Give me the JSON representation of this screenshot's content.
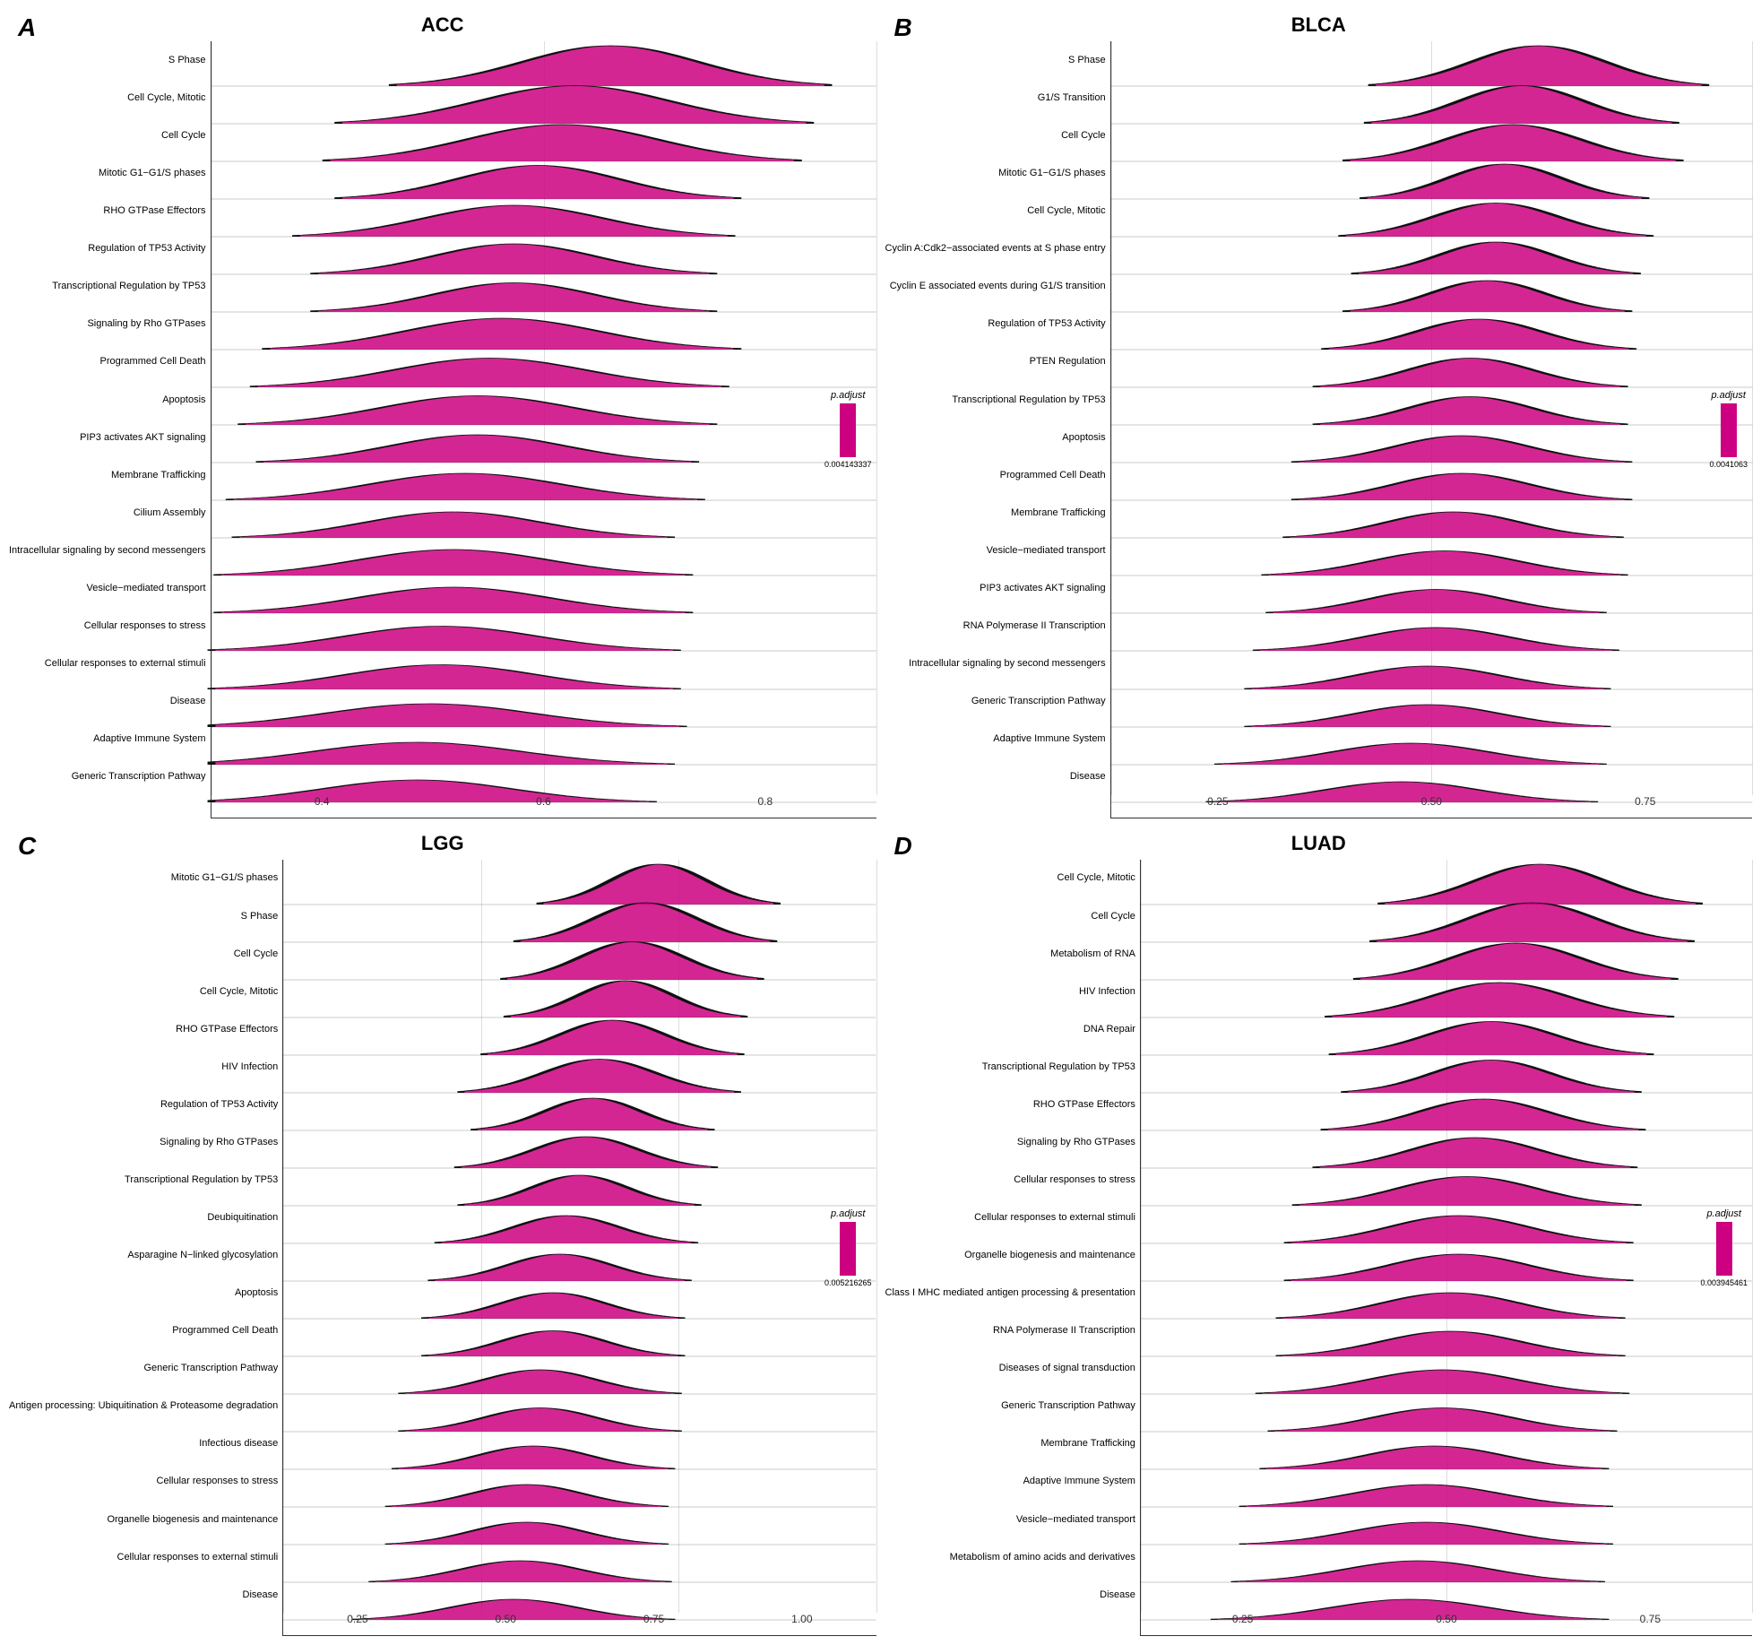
{
  "panels": [
    {
      "id": "A",
      "title": "ACC",
      "legend_value": "0.004143337",
      "x_ticks": [
        "0.4",
        "0.6",
        "0.8"
      ],
      "rows": [
        {
          "label": "S Phase",
          "peak": 0.68,
          "spread": 0.12,
          "height": 0.9
        },
        {
          "label": "Cell Cycle, Mitotic",
          "peak": 0.65,
          "spread": 0.13,
          "height": 0.85
        },
        {
          "label": "Cell Cycle",
          "peak": 0.64,
          "spread": 0.13,
          "height": 0.82
        },
        {
          "label": "Mitotic G1−G1/S phases",
          "peak": 0.62,
          "spread": 0.11,
          "height": 0.75
        },
        {
          "label": "RHO GTPase Effectors",
          "peak": 0.6,
          "spread": 0.12,
          "height": 0.7
        },
        {
          "label": "Regulation of TP53 Activity",
          "peak": 0.6,
          "spread": 0.11,
          "height": 0.68
        },
        {
          "label": "Transcriptional Regulation by TP53",
          "peak": 0.6,
          "spread": 0.11,
          "height": 0.65
        },
        {
          "label": "Signaling by Rho GTPases",
          "peak": 0.59,
          "spread": 0.13,
          "height": 0.7
        },
        {
          "label": "Programmed Cell Death",
          "peak": 0.58,
          "spread": 0.13,
          "height": 0.65
        },
        {
          "label": "Apoptosis",
          "peak": 0.57,
          "spread": 0.13,
          "height": 0.65
        },
        {
          "label": "PIP3 activates AKT signaling",
          "peak": 0.57,
          "spread": 0.12,
          "height": 0.62
        },
        {
          "label": "Membrane Trafficking",
          "peak": 0.56,
          "spread": 0.13,
          "height": 0.6
        },
        {
          "label": "Cilium Assembly",
          "peak": 0.55,
          "spread": 0.12,
          "height": 0.58
        },
        {
          "label": "Intracellular signaling by second messengers",
          "peak": 0.55,
          "spread": 0.13,
          "height": 0.58
        },
        {
          "label": "Vesicle−mediated transport",
          "peak": 0.55,
          "spread": 0.13,
          "height": 0.58
        },
        {
          "label": "Cellular responses to stress",
          "peak": 0.54,
          "spread": 0.13,
          "height": 0.55
        },
        {
          "label": "Cellular responses to external stimuli",
          "peak": 0.54,
          "spread": 0.13,
          "height": 0.55
        },
        {
          "label": "Disease",
          "peak": 0.53,
          "spread": 0.14,
          "height": 0.52
        },
        {
          "label": "Adaptive Immune System",
          "peak": 0.52,
          "spread": 0.14,
          "height": 0.5
        },
        {
          "label": "Generic Transcription Pathway",
          "peak": 0.52,
          "spread": 0.13,
          "height": 0.5
        }
      ],
      "x_min": 0.35,
      "x_max": 0.9
    },
    {
      "id": "B",
      "title": "BLCA",
      "legend_value": "0.0041063",
      "x_ticks": [
        "0.25",
        "0.50",
        "0.75"
      ],
      "rows": [
        {
          "label": "S Phase",
          "peak": 0.65,
          "spread": 0.13,
          "height": 0.9
        },
        {
          "label": "G1/S Transition",
          "peak": 0.63,
          "spread": 0.12,
          "height": 0.85
        },
        {
          "label": "Cell Cycle",
          "peak": 0.62,
          "spread": 0.13,
          "height": 0.82
        },
        {
          "label": "Mitotic G1−G1/S phases",
          "peak": 0.61,
          "spread": 0.11,
          "height": 0.78
        },
        {
          "label": "Cell Cycle, Mitotic",
          "peak": 0.6,
          "spread": 0.12,
          "height": 0.75
        },
        {
          "label": "Cyclin A:Cdk2−associated events at S phase entry",
          "peak": 0.6,
          "spread": 0.11,
          "height": 0.72
        },
        {
          "label": "Cyclin E associated events during G1/S transition",
          "peak": 0.59,
          "spread": 0.11,
          "height": 0.7
        },
        {
          "label": "Regulation of TP53 Activity",
          "peak": 0.58,
          "spread": 0.12,
          "height": 0.68
        },
        {
          "label": "PTEN Regulation",
          "peak": 0.57,
          "spread": 0.12,
          "height": 0.65
        },
        {
          "label": "Transcriptional Regulation by TP53",
          "peak": 0.57,
          "spread": 0.12,
          "height": 0.63
        },
        {
          "label": "Apoptosis",
          "peak": 0.56,
          "spread": 0.13,
          "height": 0.6
        },
        {
          "label": "Programmed Cell Death",
          "peak": 0.56,
          "spread": 0.13,
          "height": 0.6
        },
        {
          "label": "Membrane Trafficking",
          "peak": 0.55,
          "spread": 0.13,
          "height": 0.58
        },
        {
          "label": "Vesicle−mediated transport",
          "peak": 0.54,
          "spread": 0.14,
          "height": 0.55
        },
        {
          "label": "PIP3 activates AKT signaling",
          "peak": 0.53,
          "spread": 0.13,
          "height": 0.53
        },
        {
          "label": "RNA Polymerase II Transcription",
          "peak": 0.53,
          "spread": 0.14,
          "height": 0.52
        },
        {
          "label": "Intracellular signaling by second messengers",
          "peak": 0.52,
          "spread": 0.14,
          "height": 0.52
        },
        {
          "label": "Generic Transcription Pathway",
          "peak": 0.52,
          "spread": 0.14,
          "height": 0.5
        },
        {
          "label": "Adaptive Immune System",
          "peak": 0.5,
          "spread": 0.15,
          "height": 0.48
        },
        {
          "label": "Disease",
          "peak": 0.49,
          "spread": 0.15,
          "height": 0.46
        }
      ],
      "x_min": 0.15,
      "x_max": 0.9
    },
    {
      "id": "C",
      "title": "LGG",
      "legend_value": "0.005216265",
      "x_ticks": [
        "0.25",
        "0.50",
        "0.75",
        "1.00"
      ],
      "rows": [
        {
          "label": "Mitotic G1−G1/S phases",
          "peak": 0.72,
          "spread": 0.12,
          "height": 0.9
        },
        {
          "label": "S Phase",
          "peak": 0.7,
          "spread": 0.13,
          "height": 0.88
        },
        {
          "label": "Cell Cycle",
          "peak": 0.68,
          "spread": 0.13,
          "height": 0.85
        },
        {
          "label": "Cell Cycle, Mitotic",
          "peak": 0.67,
          "spread": 0.12,
          "height": 0.82
        },
        {
          "label": "RHO GTPase Effectors",
          "peak": 0.65,
          "spread": 0.13,
          "height": 0.78
        },
        {
          "label": "HIV Infection",
          "peak": 0.63,
          "spread": 0.14,
          "height": 0.75
        },
        {
          "label": "Regulation of TP53 Activity",
          "peak": 0.62,
          "spread": 0.12,
          "height": 0.72
        },
        {
          "label": "Signaling by Rho GTPases",
          "peak": 0.61,
          "spread": 0.13,
          "height": 0.7
        },
        {
          "label": "Transcriptional Regulation by TP53",
          "peak": 0.6,
          "spread": 0.12,
          "height": 0.68
        },
        {
          "label": "Deubiquitination",
          "peak": 0.58,
          "spread": 0.13,
          "height": 0.62
        },
        {
          "label": "Asparagine N−linked glycosylation",
          "peak": 0.57,
          "spread": 0.13,
          "height": 0.6
        },
        {
          "label": "Apoptosis",
          "peak": 0.56,
          "spread": 0.13,
          "height": 0.58
        },
        {
          "label": "Programmed Cell Death",
          "peak": 0.56,
          "spread": 0.13,
          "height": 0.57
        },
        {
          "label": "Generic Transcription Pathway",
          "peak": 0.54,
          "spread": 0.14,
          "height": 0.54
        },
        {
          "label": "Antigen processing: Ubiquitination & Proteasome degradation",
          "peak": 0.54,
          "spread": 0.14,
          "height": 0.53
        },
        {
          "label": "Infectious disease",
          "peak": 0.53,
          "spread": 0.14,
          "height": 0.52
        },
        {
          "label": "Cellular responses to stress",
          "peak": 0.52,
          "spread": 0.14,
          "height": 0.5
        },
        {
          "label": "Organelle biogenesis and maintenance",
          "peak": 0.52,
          "spread": 0.14,
          "height": 0.5
        },
        {
          "label": "Cellular responses to external stimuli",
          "peak": 0.51,
          "spread": 0.15,
          "height": 0.48
        },
        {
          "label": "Disease",
          "peak": 0.5,
          "spread": 0.16,
          "height": 0.46
        }
      ],
      "x_min": 0.15,
      "x_max": 1.05
    },
    {
      "id": "D",
      "title": "LUAD",
      "legend_value": "0.003945461",
      "x_ticks": [
        "0.25",
        "0.50",
        "0.75"
      ],
      "rows": [
        {
          "label": "Cell Cycle, Mitotic",
          "peak": 0.64,
          "spread": 0.13,
          "height": 0.9
        },
        {
          "label": "Cell Cycle",
          "peak": 0.63,
          "spread": 0.13,
          "height": 0.88
        },
        {
          "label": "Metabolism of RNA",
          "peak": 0.61,
          "spread": 0.13,
          "height": 0.82
        },
        {
          "label": "HIV Infection",
          "peak": 0.59,
          "spread": 0.14,
          "height": 0.78
        },
        {
          "label": "DNA Repair",
          "peak": 0.58,
          "spread": 0.13,
          "height": 0.75
        },
        {
          "label": "Transcriptional Regulation by TP53",
          "peak": 0.58,
          "spread": 0.12,
          "height": 0.73
        },
        {
          "label": "RHO GTPase Effectors",
          "peak": 0.57,
          "spread": 0.13,
          "height": 0.7
        },
        {
          "label": "Signaling by Rho GTPases",
          "peak": 0.56,
          "spread": 0.13,
          "height": 0.68
        },
        {
          "label": "Cellular responses to stress",
          "peak": 0.55,
          "spread": 0.14,
          "height": 0.65
        },
        {
          "label": "Cellular responses to external stimuli",
          "peak": 0.54,
          "spread": 0.14,
          "height": 0.62
        },
        {
          "label": "Organelle biogenesis and maintenance",
          "peak": 0.54,
          "spread": 0.14,
          "height": 0.6
        },
        {
          "label": "Class I MHC mediated antigen processing & presentation",
          "peak": 0.53,
          "spread": 0.14,
          "height": 0.58
        },
        {
          "label": "RNA Polymerase II Transcription",
          "peak": 0.53,
          "spread": 0.14,
          "height": 0.56
        },
        {
          "label": "Diseases of signal transduction",
          "peak": 0.52,
          "spread": 0.15,
          "height": 0.54
        },
        {
          "label": "Generic Transcription Pathway",
          "peak": 0.52,
          "spread": 0.14,
          "height": 0.53
        },
        {
          "label": "Membrane Trafficking",
          "peak": 0.51,
          "spread": 0.14,
          "height": 0.52
        },
        {
          "label": "Adaptive Immune System",
          "peak": 0.5,
          "spread": 0.15,
          "height": 0.5
        },
        {
          "label": "Vesicle−mediated transport",
          "peak": 0.5,
          "spread": 0.15,
          "height": 0.5
        },
        {
          "label": "Metabolism of amino acids and derivatives",
          "peak": 0.49,
          "spread": 0.15,
          "height": 0.48
        },
        {
          "label": "Disease",
          "peak": 0.48,
          "spread": 0.16,
          "height": 0.46
        }
      ],
      "x_min": 0.15,
      "x_max": 0.9
    }
  ],
  "magenta_color": "#CC0080",
  "labels": {
    "A": "A",
    "B": "B",
    "C": "C",
    "D": "D",
    "padjust": "p.adjust"
  }
}
